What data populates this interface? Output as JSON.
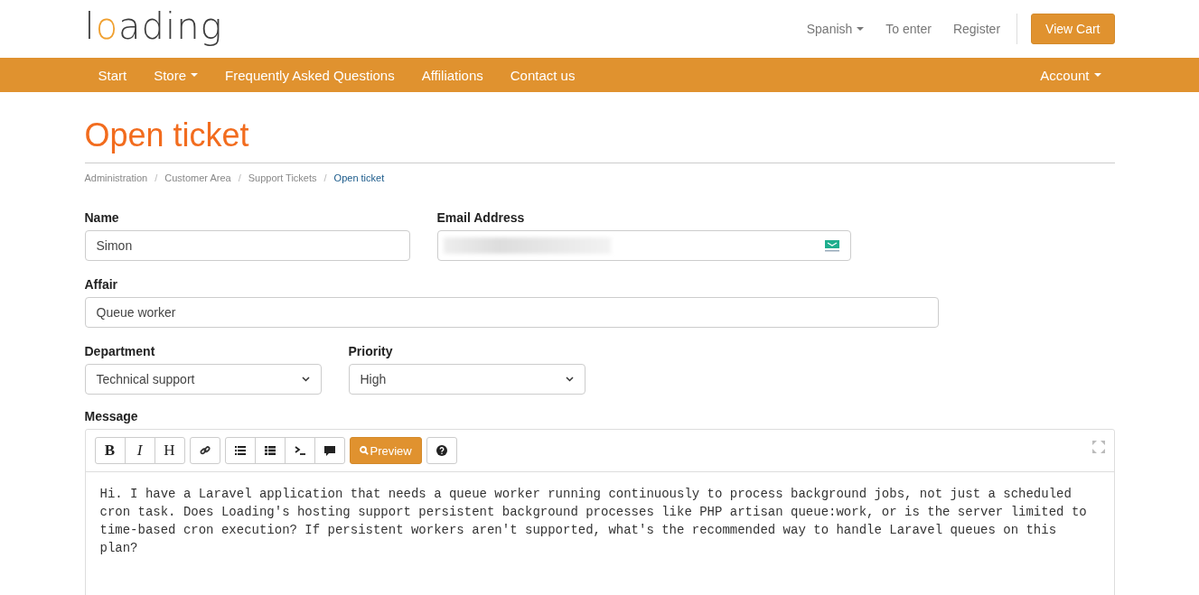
{
  "logo": {
    "text": "loading"
  },
  "top_links": [
    {
      "label": "Spanish",
      "dropdown": true
    },
    {
      "label": "To enter",
      "dropdown": false
    },
    {
      "label": "Register",
      "dropdown": false
    }
  ],
  "cart_button": "View Cart",
  "nav": {
    "items": [
      {
        "label": "Start",
        "dropdown": false
      },
      {
        "label": "Store",
        "dropdown": true
      },
      {
        "label": "Frequently Asked Questions",
        "dropdown": false
      },
      {
        "label": "Affiliations",
        "dropdown": false
      },
      {
        "label": "Contact us",
        "dropdown": false
      }
    ],
    "right": [
      {
        "label": "Account",
        "dropdown": true
      }
    ]
  },
  "page_title": "Open ticket",
  "breadcrumb": [
    {
      "label": "Administration",
      "selected": false
    },
    {
      "separator": "/",
      "label": "Customer Area",
      "selected": false
    },
    {
      "separator": "/",
      "label": "Support Tickets",
      "selected": false
    },
    {
      "separator": "/",
      "label": "Open ticket",
      "selected": true
    }
  ],
  "form": {
    "name": {
      "label": "Name",
      "value": "Simon"
    },
    "email": {
      "label": "Email Address",
      "blurred": true
    },
    "affair": {
      "label": "Affair",
      "value": "Queue worker"
    },
    "department": {
      "label": "Department",
      "value": "Technical support"
    },
    "priority": {
      "label": "Priority",
      "value": "High"
    },
    "message": {
      "label": "Message",
      "value": "Hi. I have a Laravel application that needs a queue worker running continuously to process background jobs, not just a scheduled cron task. Does Loading's hosting support persistent background processes like PHP artisan queue:work, or is the server limited to time-based cron execution? If persistent workers aren't supported, what's the recommended way to handle Laravel queues on this plan?"
    }
  },
  "editor_toolbar": {
    "groups": [
      [
        {
          "kind": "bold",
          "label": "B"
        },
        {
          "kind": "italic",
          "label": "I"
        },
        {
          "kind": "heading",
          "label": "H"
        }
      ],
      [
        {
          "kind": "link"
        }
      ],
      [
        {
          "kind": "list"
        },
        {
          "kind": "numbered"
        },
        {
          "kind": "code"
        },
        {
          "kind": "quote"
        }
      ],
      [
        {
          "kind": "preview",
          "label": "Preview"
        }
      ],
      [
        {
          "kind": "help"
        }
      ]
    ]
  }
}
